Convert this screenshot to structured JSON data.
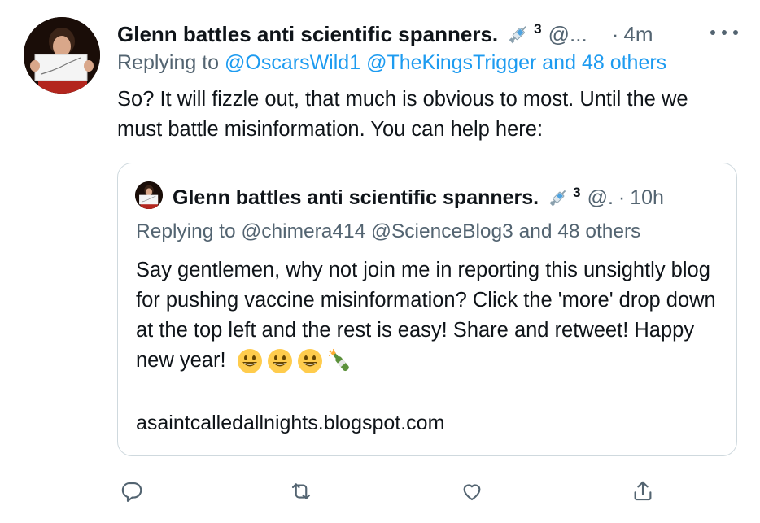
{
  "tweet": {
    "author_name": "Glenn battles anti scientific spanners.",
    "badge_count": "3",
    "handle": "@...",
    "separator": "·",
    "time": "4m",
    "replying_to_label": "Replying to",
    "replying_to_mentions": [
      "@OscarsWild1",
      "@TheKingsTrigger",
      "and 48 others"
    ],
    "text": "So? It will fizzle out, that much is obvious to most. Until the we must battle misinformation. You can help here:"
  },
  "quoted_tweet": {
    "author_name": "Glenn battles anti scientific spanners.",
    "badge_count": "3",
    "handle": "@.",
    "separator": "·",
    "time": "10h",
    "replying_to": "Replying to @chimera414 @ScienceBlog3 and 48 others",
    "text": "Say gentlemen, why not join me in reporting this unsightly blog for pushing vaccine misinformation? Click the 'more' drop down at the top left and the rest is easy! Share and retweet! Happy new year!",
    "emojis": [
      "grinning-face-icon",
      "grinning-face-icon",
      "grinning-face-icon",
      "champagne-bottle-icon"
    ],
    "link": "asaintcalledallnights.blogspot.com"
  },
  "icons": {
    "more": "more-horizontal-icon",
    "badge": "syringe-icon",
    "actions": [
      "reply-icon",
      "retweet-icon",
      "like-icon",
      "share-icon"
    ]
  },
  "colors": {
    "text": "#0f1419",
    "secondary": "#536471",
    "link": "#1d9bf0",
    "border": "#cfd9de"
  }
}
